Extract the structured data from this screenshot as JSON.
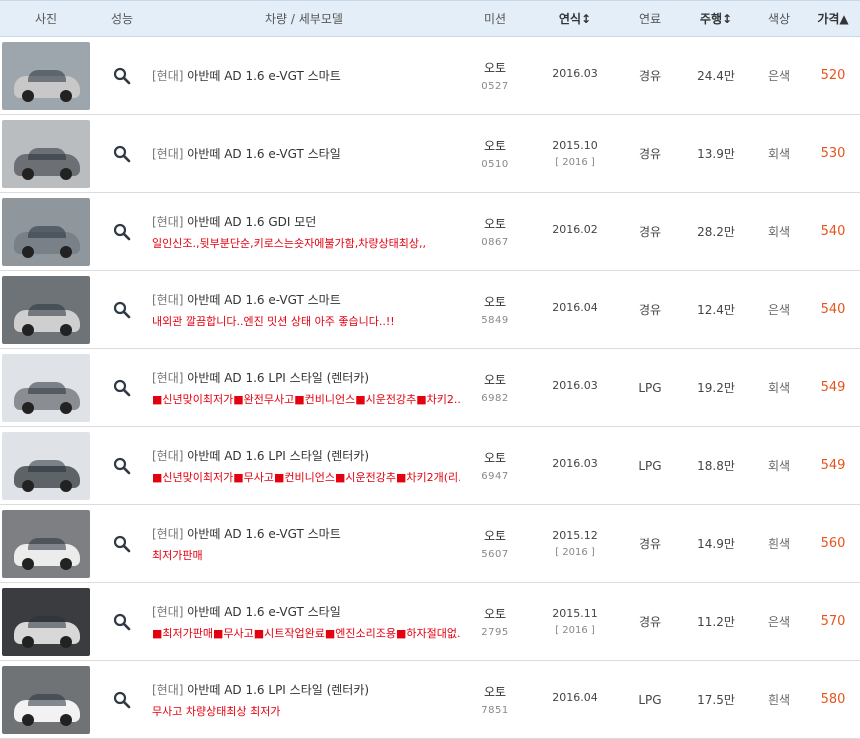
{
  "header": {
    "photo": "사진",
    "perf": "성능",
    "model": "차량 / 세부모델",
    "mission": "미션",
    "year": "연식↕",
    "fuel": "연료",
    "km": "주행↕",
    "color": "색상",
    "price": "가격▲"
  },
  "icons": {
    "search": "magnifier-icon"
  },
  "rows": [
    {
      "brand": "[현대]",
      "model": "아반떼 AD 1.6 e-VGT 스마트",
      "desc": "",
      "mission": "오토",
      "mission_id": "0527",
      "year": "2016.03",
      "year_sub": "",
      "fuel": "경유",
      "km": "24.4만",
      "color": "은색",
      "price": "520",
      "paint": "#c8c8c8",
      "bg": "#9ea6ad"
    },
    {
      "brand": "[현대]",
      "model": "아반떼 AD 1.6 e-VGT 스타일",
      "desc": "",
      "mission": "오토",
      "mission_id": "0510",
      "year": "2015.10",
      "year_sub": "[ 2016 ]",
      "fuel": "경유",
      "km": "13.9만",
      "color": "회색",
      "price": "530",
      "paint": "#6c7074",
      "bg": "#b9bdc0"
    },
    {
      "brand": "[현대]",
      "model": "아반떼 AD 1.6 GDI 모던",
      "desc": "일인신조.,뒷부분단순,키로스는숏자에불가함,차량상태최상,,",
      "mission": "오토",
      "mission_id": "0867",
      "year": "2016.02",
      "year_sub": "",
      "fuel": "경유",
      "km": "28.2만",
      "color": "회색",
      "price": "540",
      "paint": "#7a8088",
      "bg": "#8f969c"
    },
    {
      "brand": "[현대]",
      "model": "아반떼 AD 1.6 e-VGT 스마트",
      "desc": "내외관 깔끔합니다..엔진 밋션 상태 아주 좋습니다..!!",
      "mission": "오토",
      "mission_id": "5849",
      "year": "2016.04",
      "year_sub": "",
      "fuel": "경유",
      "km": "12.4만",
      "color": "은색",
      "price": "540",
      "paint": "#cfcfcf",
      "bg": "#6e7378"
    },
    {
      "brand": "[현대]",
      "model": "아반떼 AD 1.6 LPI 스타일 (렌터카)",
      "desc": "■신년맞이최저가■완전무사고■컨비니언스■시운전강추■차키2...",
      "mission": "오토",
      "mission_id": "6982",
      "year": "2016.03",
      "year_sub": "",
      "fuel": "LPG",
      "km": "19.2만",
      "color": "회색",
      "price": "549",
      "paint": "#8a8e93",
      "bg": "#dfe3e7"
    },
    {
      "brand": "[현대]",
      "model": "아반떼 AD 1.6 LPI 스타일 (렌터카)",
      "desc": "■신년맞이최저가■무사고■컨비니언스■시운전강추■차키2개(리...",
      "mission": "오토",
      "mission_id": "6947",
      "year": "2016.03",
      "year_sub": "",
      "fuel": "LPG",
      "km": "18.8만",
      "color": "회색",
      "price": "549",
      "paint": "#5e6368",
      "bg": "#dfe3e7"
    },
    {
      "brand": "[현대]",
      "model": "아반떼 AD 1.6 e-VGT 스마트",
      "desc": "최저가판매",
      "mission": "오토",
      "mission_id": "5607",
      "year": "2015.12",
      "year_sub": "[ 2016 ]",
      "fuel": "경유",
      "km": "14.9만",
      "color": "흰색",
      "price": "560",
      "paint": "#ececec",
      "bg": "#7d7f82"
    },
    {
      "brand": "[현대]",
      "model": "아반떼 AD 1.6 e-VGT 스타일",
      "desc": "■최저가판매■무사고■시트작업완료■엔진소리조용■하자절대없...",
      "mission": "오토",
      "mission_id": "2795",
      "year": "2015.11",
      "year_sub": "[ 2016 ]",
      "fuel": "경유",
      "km": "11.2만",
      "color": "은색",
      "price": "570",
      "paint": "#d8d8d8",
      "bg": "#3a3c3f"
    },
    {
      "brand": "[현대]",
      "model": "아반떼 AD 1.6 LPI 스타일 (렌터카)",
      "desc": "무사고 차량상태최상 최저가",
      "mission": "오토",
      "mission_id": "7851",
      "year": "2016.04",
      "year_sub": "",
      "fuel": "LPG",
      "km": "17.5만",
      "color": "흰색",
      "price": "580",
      "paint": "#f2f2f2",
      "bg": "#707376"
    }
  ]
}
